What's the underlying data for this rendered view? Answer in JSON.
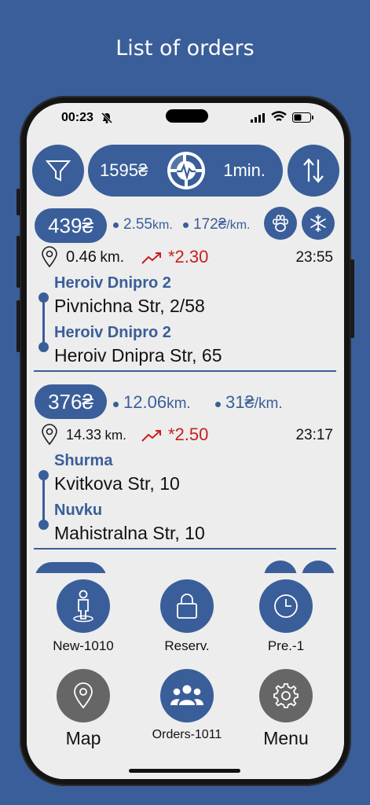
{
  "header": {
    "title": "List of orders"
  },
  "status_bar": {
    "time": "00:23"
  },
  "summary": {
    "total_amount": "1595₴",
    "eta": "1min."
  },
  "orders": [
    {
      "price": "439₴",
      "distance": "2.55",
      "distance_unit": "km.",
      "rate": "172₴",
      "rate_unit": "/km.",
      "pickup_distance": "0.46",
      "pickup_unit": "km.",
      "surge": "*2.30",
      "time": "23:55",
      "features": [
        "paw-icon",
        "snowflake-icon"
      ],
      "stops": [
        {
          "city": "Heroiv Dnipro 2",
          "street": "Pivnichna Str, 2/58"
        },
        {
          "city": "Heroiv Dnipro 2",
          "street": "Heroiv Dnipra Str, 65"
        }
      ]
    },
    {
      "price": "376₴",
      "distance": "12.06",
      "distance_unit": "km.",
      "rate": "31₴",
      "rate_unit": "/km.",
      "pickup_distance": "14.33",
      "pickup_unit": "km.",
      "surge": "*2.50",
      "time": "23:17",
      "stops": [
        {
          "city": "Shurma",
          "street": "Kvitkova Str, 10"
        },
        {
          "city": "Nuvku",
          "street": "Mahistralna Str, 10"
        }
      ]
    }
  ],
  "nav": {
    "new": "New-1010",
    "reserved": "Reserv.",
    "pre": "Pre.-1",
    "map": "Map",
    "orders": "Orders-1011",
    "menu": "Menu"
  },
  "colors": {
    "primary": "#3a5e99",
    "surge": "#c81e1e",
    "background": "#ededed",
    "gray_button": "#666666"
  }
}
